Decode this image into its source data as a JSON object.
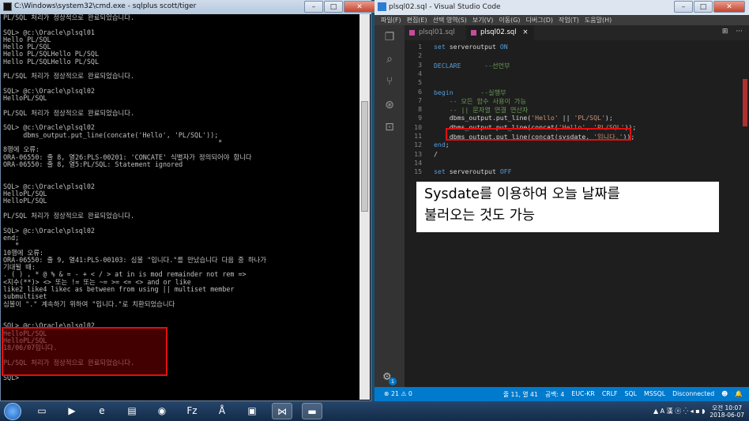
{
  "cmd": {
    "title": "C:\\Windows\\system32\\cmd.exe - sqlplus  scott/tiger",
    "lines": [
      "PL/SQL 처리가 정상적으로 완료되었습니다.",
      "",
      "SQL> @c:\\Oracle\\plsql01",
      "Hello PL/SQL",
      "Hello PL/SQL",
      "Hello PL/SQLHello PL/SQL",
      "Hello PL/SQLHello PL/SQL",
      "",
      "PL/SQL 처리가 정상적으로 완료되었습니다.",
      "",
      "SQL> @c:\\Oracle\\plsql02",
      "HelloPL/SQL",
      "",
      "PL/SQL 처리가 정상적으로 완료되었습니다.",
      "",
      "SQL> @c:\\Oracle\\plsql02",
      "     dbms_output.put_line(concate('Hello', 'PL/SQL'));",
      "                                                      *",
      "8행에 오류:",
      "ORA-06550: 줄 8, 열26:PLS-00201: 'CONCATE' 식별자가 정의되어야 합니다",
      "ORA-06550: 줄 8, 열5:PL/SQL: Statement ignored",
      "",
      "",
      "SQL> @c:\\Oracle\\plsql02",
      "HelloPL/SQL",
      "HelloPL/SQL",
      "",
      "PL/SQL 처리가 정상적으로 완료되었습니다.",
      "",
      "SQL> @c:\\Oracle\\plsql02",
      "end;",
      "   *",
      "10행에 오류:",
      "ORA-06550: 줄 9, 열41:PLS-00103: 심볼 \"입니다.\"를 만났습니다 다음 중 하나가",
      "기대될 때:",
      ". ( ) , * @ % & = - + < / > at in is mod remainder not rem =>",
      "<지수(**)> <> 또는 != 또는 ~= >= <= <> and or like",
      "like2 like4 likec as between from using || multiset member",
      "submultiset",
      "심볼이 \".\" 계속하기 위하여 \"입니다.\"로 치환되었습니다",
      "",
      "",
      "SQL> @c:\\Oracle\\plsql02",
      "HelloPL/SQL",
      "HelloPL/SQL",
      "18/06/07입니다.",
      "",
      "PL/SQL 처리가 정상적으로 완료되었습니다.",
      "",
      "SQL>"
    ]
  },
  "vscode": {
    "title": "plsql02.sql - Visual Studio Code",
    "menu": [
      "파일(F)",
      "편집(E)",
      "선택 영역(S)",
      "보기(V)",
      "이동(G)",
      "디버그(D)",
      "작업(T)",
      "도움말(H)"
    ],
    "tabs": [
      {
        "label": "plsql01.sql"
      },
      {
        "label": "plsql02.sql",
        "close": "×"
      }
    ],
    "tab_actions": [
      "⊞",
      "···"
    ],
    "code": [
      {
        "n": "1",
        "html": "<span class='kw'>set</span> serveroutput <span class='kw'>ON</span>"
      },
      {
        "n": "2",
        "html": ""
      },
      {
        "n": "3",
        "html": "<span class='kw'>DECLARE</span>      <span class='cm'>--선언부</span>"
      },
      {
        "n": "4",
        "html": ""
      },
      {
        "n": "5",
        "html": ""
      },
      {
        "n": "6",
        "html": "<span class='kw'>begin</span>       <span class='cm'>--실행부</span>"
      },
      {
        "n": "7",
        "html": "    <span class='cm'>-- 모든 함수 사용이 가능</span>"
      },
      {
        "n": "8",
        "html": "    <span class='cm'>-- || 문자열 연결 연산자</span>"
      },
      {
        "n": "9",
        "html": "    dbms_output.put_line(<span class='st'>'Hello'</span> || <span class='st'>'PL/SQL'</span>);"
      },
      {
        "n": "10",
        "html": "    dbms_output.put_line(concat(<span class='st'>'Hello'</span>, <span class='st'>'PL/SQL'</span>));"
      },
      {
        "n": "11",
        "html": "    dbms_output.put_line(concat(sysdate, <span class='st'>'입니다.'</span>));"
      },
      {
        "n": "12",
        "html": "<span class='kw'>end</span>;"
      },
      {
        "n": "13",
        "html": "/"
      },
      {
        "n": "14",
        "html": ""
      },
      {
        "n": "15",
        "html": "<span class='kw'>set</span> serveroutput <span class='kw'>OFF</span>"
      }
    ],
    "status_left": "⊗ 21 ⚠ 0",
    "status_right": [
      "줄 11, 열 41",
      "공백: 4",
      "EUC-KR",
      "CRLF",
      "SQL",
      "MSSQL",
      "Disconnected",
      "☻",
      "🔔"
    ],
    "badge": "1"
  },
  "note": {
    "line1": "Sysdate를 이용하여 오늘 날짜를",
    "line2": "불러오는 것도 가능"
  },
  "taskbar": {
    "apps": [
      "▭",
      "▶",
      "e",
      "▤",
      "◉",
      "Fz",
      "Å",
      "▣",
      "⋈",
      "▬"
    ],
    "tray": "▲ A 漢 ⓞ ⁛ ◂ ▪ ◗",
    "time": "오전 10:07",
    "date": "2018-06-07"
  }
}
